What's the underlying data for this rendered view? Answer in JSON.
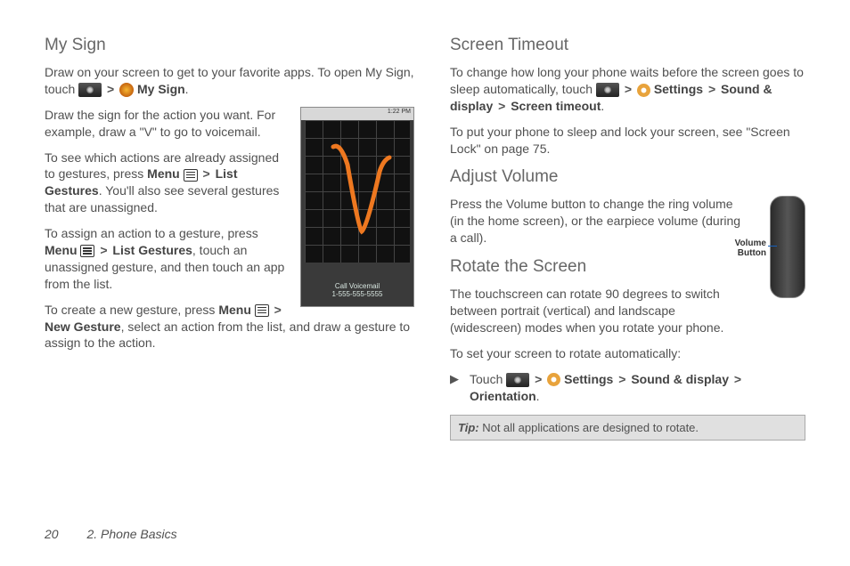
{
  "left": {
    "h_mysign": "My Sign",
    "p1a": "Draw on your screen to get to your favorite apps. To open My Sign, touch ",
    "p1b": " My Sign",
    "p1c": ".",
    "p2": "Draw the sign for the action you want. For example, draw a \"V\" to go to voicemail.",
    "p3a": "To see which actions are already assigned to gestures, press ",
    "p3b": "Menu",
    "p3c": " List Gestures",
    "p3d": ". You'll also see several gestures that are unassigned.",
    "p4a": "To assign an action to a gesture, press ",
    "p4b": "Menu",
    "p4c": " List Gestures",
    "p4d": ", touch an unassigned gesture, and then touch an app from the list.",
    "p5a": "To create a new gesture, press ",
    "p5b": "Menu",
    "p5c": " New Gesture",
    "p5d": ", select an action from the list, and draw a gesture to assign to the action.",
    "shot_status": "1:22 PM",
    "shot_caption1": "Call Voicemail",
    "shot_caption2": "1-555-555-5555"
  },
  "right": {
    "h_timeout": "Screen Timeout",
    "t1a": "To change how long your phone waits before the screen goes to sleep automatically, touch ",
    "t1b": " Settings",
    "t1c": " Sound & display",
    "t1d": " Screen timeout",
    "t1e": ".",
    "t2": "To put your phone to sleep and lock your screen, see \"Screen Lock\" on page 75.",
    "h_volume": "Adjust Volume",
    "v1": "Press the Volume button to change the ring volume (in the home screen), or the earpiece volume (during a call).",
    "vol_label": "Volume Button",
    "h_rotate": "Rotate the Screen",
    "r1": "The touchscreen can rotate 90 degrees to switch between portrait (vertical) and landscape (widescreen) modes when you rotate your phone.",
    "r2": "To set your screen to rotate automatically:",
    "r3a": "Touch ",
    "r3b": " Settings",
    "r3c": " Sound & display",
    "r3d": " Orientation",
    "r3e": ".",
    "tip_label": "Tip:",
    "tip_text": "  Not all applications are designed to rotate."
  },
  "footer": {
    "page": "20",
    "section": "2. Phone Basics"
  },
  "glyphs": {
    "gt": ">",
    "bullet": "▶"
  }
}
